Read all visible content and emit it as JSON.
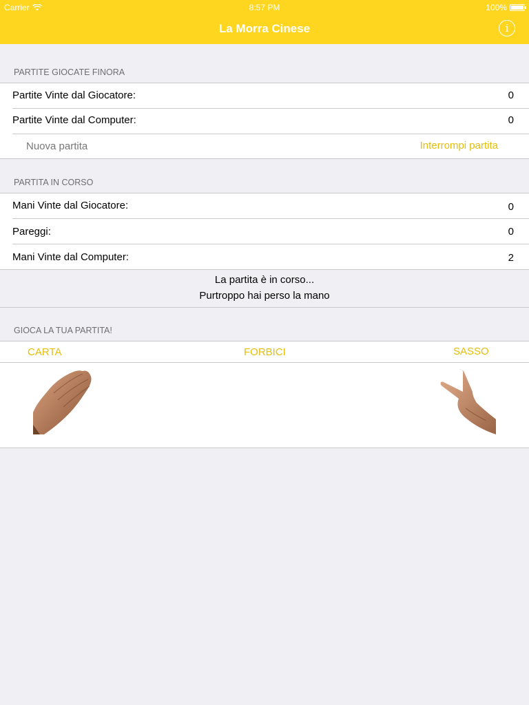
{
  "status_bar": {
    "carrier": "Carrier",
    "time": "8:57 PM",
    "battery": "100%"
  },
  "nav": {
    "title": "La Morra Cinese",
    "info_icon": "info-icon"
  },
  "games_section": {
    "header": "PARTITE GIOCATE FINORA",
    "player_label": "Partite Vinte dal Giocatore:",
    "player_value": "0",
    "computer_label": "Partite Vinte dal Computer:",
    "computer_value": "0",
    "new_game": "Nuova partita",
    "stop_game": "Interrompi partita"
  },
  "current_section": {
    "header": "PARTITA IN CORSO",
    "player_label": "Mani Vinte dal Giocatore:",
    "player_value": "0",
    "draws_label": "Pareggi:",
    "draws_value": "0",
    "computer_label": "Mani Vinte dal Computer:",
    "computer_value": "2"
  },
  "status": {
    "line1": "La partita è in corso...",
    "line2": "Purtroppo hai perso la mano"
  },
  "play_section": {
    "header": "GIOCA LA TUA PARTITA!",
    "paper": "CARTA",
    "scissors": "FORBICI",
    "rock": "SASSO"
  },
  "colors": {
    "accent": "#fed61f",
    "accent_text": "#e5be08",
    "background": "#efeff4"
  }
}
